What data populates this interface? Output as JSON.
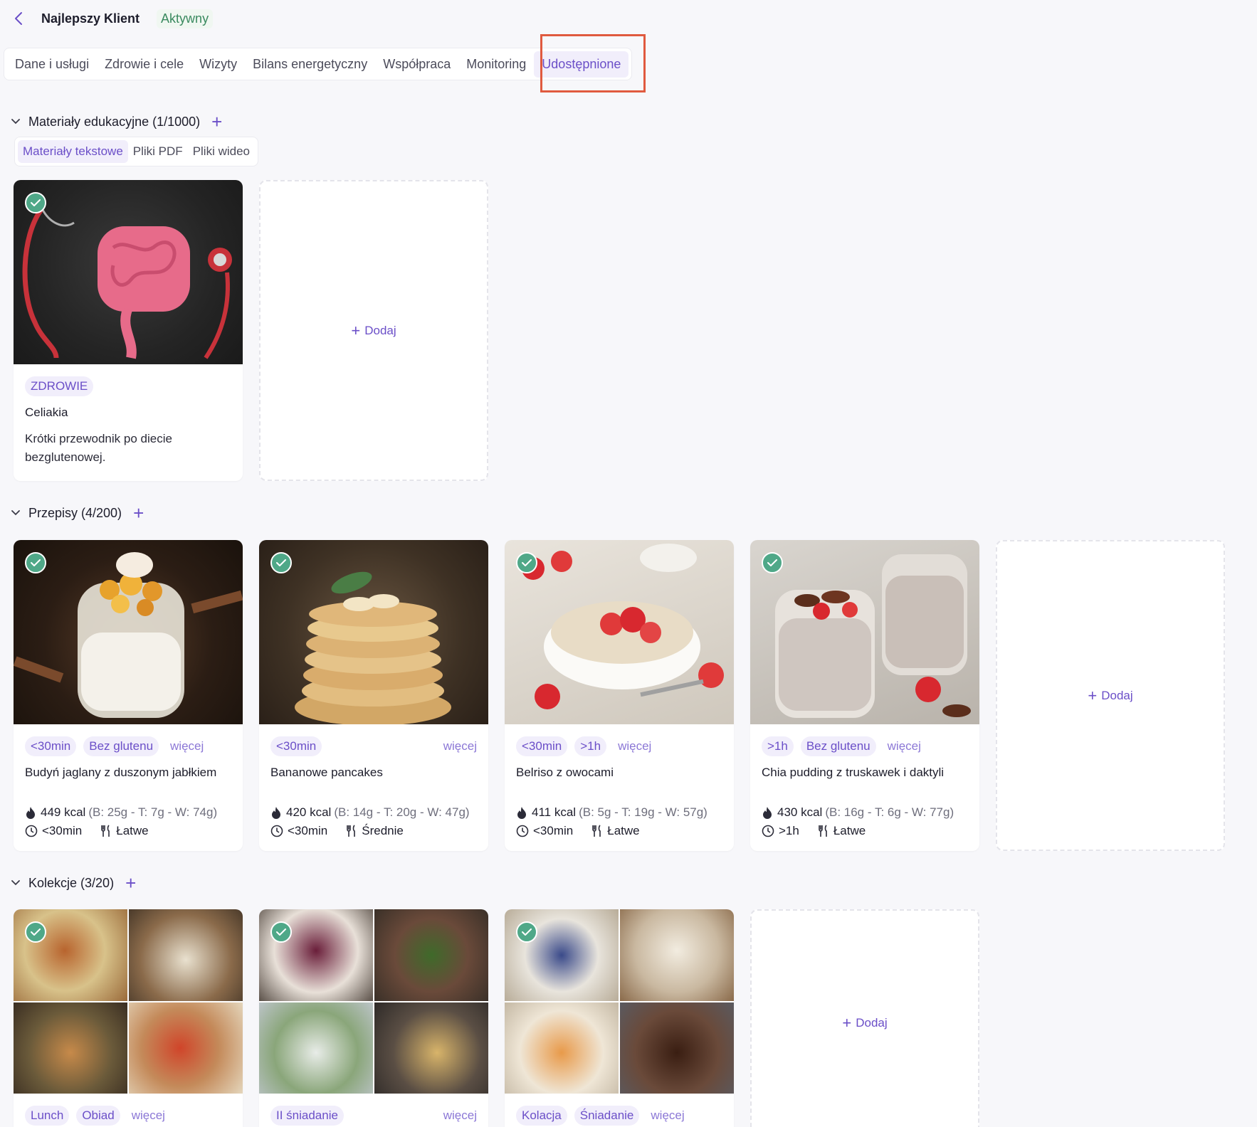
{
  "header": {
    "client_name": "Najlepszy Klient",
    "status": "Aktywny"
  },
  "tabs": [
    "Dane i usługi",
    "Zdrowie i cele",
    "Wizyty",
    "Bilans energetyczny",
    "Współpraca",
    "Monitoring",
    "Udostępnione"
  ],
  "active_tab": "Udostępnione",
  "education": {
    "title": "Materiały edukacyjne (1/1000)",
    "subtabs": [
      "Materiały tekstowe",
      "Pliki PDF",
      "Pliki wideo"
    ],
    "card": {
      "tag": "ZDROWIE",
      "title": "Celiakia",
      "desc": "Krótki przewodnik po diecie bezglutenowej."
    },
    "add_label": "Dodaj"
  },
  "recipes": {
    "title": "Przepisy (4/200)",
    "more_label": "więcej",
    "add_label": "Dodaj",
    "items": [
      {
        "tags": [
          "<30min",
          "Bez glutenu"
        ],
        "title": "Budyń jaglany z duszonym jabłkiem",
        "kcal": "449 kcal",
        "macros": "(B: 25g - T: 7g - W: 74g)",
        "time": "<30min",
        "difficulty": "Łatwe"
      },
      {
        "tags": [
          "<30min"
        ],
        "title": "Bananowe pancakes",
        "kcal": "420 kcal",
        "macros": "(B: 14g - T: 20g - W: 47g)",
        "time": "<30min",
        "difficulty": "Średnie"
      },
      {
        "tags": [
          "<30min",
          ">1h"
        ],
        "title": "Belriso z owocami",
        "kcal": "411 kcal",
        "macros": "(B: 5g - T: 19g - W: 57g)",
        "time": "<30min",
        "difficulty": "Łatwe"
      },
      {
        "tags": [
          ">1h",
          "Bez glutenu"
        ],
        "title": "Chia pudding z truskawek i daktyli",
        "kcal": "430 kcal",
        "macros": "(B: 16g - T: 6g - W: 77g)",
        "time": ">1h",
        "difficulty": "Łatwe"
      }
    ]
  },
  "collections": {
    "title": "Kolekcje (3/20)",
    "more_label": "więcej",
    "add_label": "Dodaj",
    "items": [
      {
        "tags": [
          "Lunch",
          "Obiad"
        ]
      },
      {
        "tags": [
          "II śniadanie"
        ]
      },
      {
        "tags": [
          "Kolacja",
          "Śniadanie"
        ]
      }
    ]
  },
  "colors": {
    "accent": "#6b4fc8",
    "status_green": "#3a8a5f",
    "check_green": "#4fa888",
    "highlight": "#e05a3f"
  }
}
